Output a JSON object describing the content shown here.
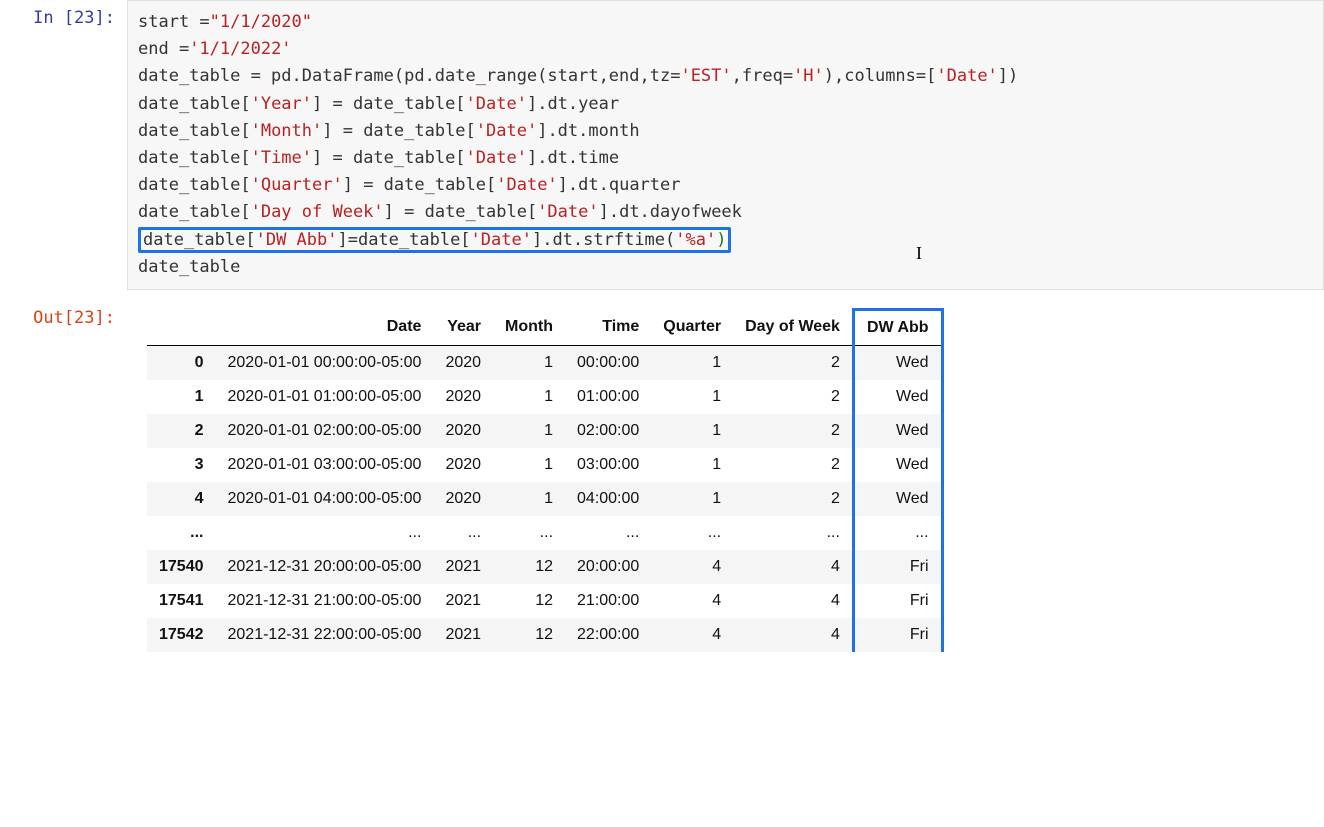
{
  "in_prompt": "In [23]:",
  "out_prompt": "Out[23]:",
  "code": {
    "l1a": "start =",
    "l1b": "\"1/1/2020\"",
    "l2a": "end =",
    "l2b": "'1/1/2022'",
    "l3a": "date_table = pd.DataFrame(pd.date_range(start,end,tz=",
    "l3b": "'EST'",
    "l3c": ",freq=",
    "l3d": "'H'",
    "l3e": "),columns=[",
    "l3f": "'Date'",
    "l3g": "])",
    "l4a": "date_table[",
    "l4b": "'Year'",
    "l4c": "] = date_table[",
    "l4d": "'Date'",
    "l4e": "].dt.year",
    "l5a": "date_table[",
    "l5b": "'Month'",
    "l5c": "] = date_table[",
    "l5d": "'Date'",
    "l5e": "].dt.month",
    "l6a": "date_table[",
    "l6b": "'Time'",
    "l6c": "] = date_table[",
    "l6d": "'Date'",
    "l6e": "].dt.time",
    "l7a": "date_table[",
    "l7b": "'Quarter'",
    "l7c": "] = date_table[",
    "l7d": "'Date'",
    "l7e": "].dt.quarter",
    "l8a": "date_table[",
    "l8b": "'Day of Week'",
    "l8c": "] = date_table[",
    "l8d": "'Date'",
    "l8e": "].dt.dayofweek",
    "l9a": "date_table[",
    "l9b": "'DW Abb'",
    "l9c": "]=date_table[",
    "l9d": "'Date'",
    "l9e": "].dt.strftime(",
    "l9f": "'%a'",
    "l9g": ")",
    "l10": "date_table"
  },
  "table": {
    "columns": [
      "Date",
      "Year",
      "Month",
      "Time",
      "Quarter",
      "Day of Week",
      "DW Abb"
    ],
    "rows": [
      {
        "idx": "0",
        "Date": "2020-01-01 00:00:00-05:00",
        "Year": "2020",
        "Month": "1",
        "Time": "00:00:00",
        "Quarter": "1",
        "DayOfWeek": "2",
        "DWAbb": "Wed"
      },
      {
        "idx": "1",
        "Date": "2020-01-01 01:00:00-05:00",
        "Year": "2020",
        "Month": "1",
        "Time": "01:00:00",
        "Quarter": "1",
        "DayOfWeek": "2",
        "DWAbb": "Wed"
      },
      {
        "idx": "2",
        "Date": "2020-01-01 02:00:00-05:00",
        "Year": "2020",
        "Month": "1",
        "Time": "02:00:00",
        "Quarter": "1",
        "DayOfWeek": "2",
        "DWAbb": "Wed"
      },
      {
        "idx": "3",
        "Date": "2020-01-01 03:00:00-05:00",
        "Year": "2020",
        "Month": "1",
        "Time": "03:00:00",
        "Quarter": "1",
        "DayOfWeek": "2",
        "DWAbb": "Wed"
      },
      {
        "idx": "4",
        "Date": "2020-01-01 04:00:00-05:00",
        "Year": "2020",
        "Month": "1",
        "Time": "04:00:00",
        "Quarter": "1",
        "DayOfWeek": "2",
        "DWAbb": "Wed"
      },
      {
        "idx": "...",
        "Date": "...",
        "Year": "...",
        "Month": "...",
        "Time": "...",
        "Quarter": "...",
        "DayOfWeek": "...",
        "DWAbb": "..."
      },
      {
        "idx": "17540",
        "Date": "2021-12-31 20:00:00-05:00",
        "Year": "2021",
        "Month": "12",
        "Time": "20:00:00",
        "Quarter": "4",
        "DayOfWeek": "4",
        "DWAbb": "Fri"
      },
      {
        "idx": "17541",
        "Date": "2021-12-31 21:00:00-05:00",
        "Year": "2021",
        "Month": "12",
        "Time": "21:00:00",
        "Quarter": "4",
        "DayOfWeek": "4",
        "DWAbb": "Fri"
      },
      {
        "idx": "17542",
        "Date": "2021-12-31 22:00:00-05:00",
        "Year": "2021",
        "Month": "12",
        "Time": "22:00:00",
        "Quarter": "4",
        "DayOfWeek": "4",
        "DWAbb": "Fri"
      }
    ]
  }
}
